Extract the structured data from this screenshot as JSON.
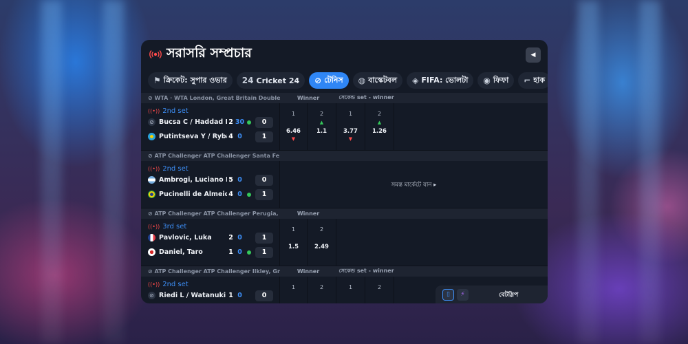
{
  "header": {
    "title": "সরাসরি সম্প্রচার"
  },
  "tabs": [
    {
      "label": "ক্রিকেট: সুপার ওভার",
      "icon": "cricket-icon",
      "active": false
    },
    {
      "label": "Cricket 24",
      "icon": "cricket24-icon",
      "active": false
    },
    {
      "label": "টেনিস",
      "icon": "tennis-icon",
      "active": true
    },
    {
      "label": "বাস্কেটবল",
      "icon": "basketball-icon",
      "active": false
    },
    {
      "label": "FIFA: ভোলটা",
      "icon": "fifa-icon",
      "active": false
    },
    {
      "label": "ফিফা",
      "icon": "soccer-icon",
      "active": false
    },
    {
      "label": "হাক",
      "icon": "hockey-icon",
      "active": false
    }
  ],
  "events": [
    {
      "league": "WTA · WTA London, Great Britain Doubles",
      "market_headers": [
        "Winner",
        "সেকেন্ড set - winner"
      ],
      "set": "2nd set",
      "players": [
        {
          "name": "Bucsa C / Haddad Maia",
          "sets": "2",
          "points": "30",
          "serving": true,
          "games": "0"
        },
        {
          "name": "Putintseva Y / Rybakina",
          "sets": "4",
          "points": "0",
          "serving": false,
          "games": "1"
        }
      ],
      "odds": [
        {
          "label": "1",
          "value": "6.46",
          "trend": "down"
        },
        {
          "label": "2",
          "value": "1.1",
          "trend": "up"
        },
        {
          "label": "1",
          "value": "3.77",
          "trend": "down"
        },
        {
          "label": "2",
          "value": "1.26",
          "trend": "up"
        }
      ]
    },
    {
      "league": "ATP Challenger ATP Challenger Santa Fe",
      "set": "2nd set",
      "players": [
        {
          "name": "Ambrogi, Luciano Emanuel",
          "sets": "5",
          "points": "0",
          "serving": false,
          "games": "0"
        },
        {
          "name": "Pucinelli de Almeida, Matheus",
          "sets": "4",
          "points": "0",
          "serving": true,
          "games": "1"
        }
      ],
      "all_markets": "সমস্ত মার্কেটে যান ▸"
    },
    {
      "league": "ATP Challenger ATP Challenger Perugia, Italy",
      "market_headers": [
        "Winner"
      ],
      "set": "3rd set",
      "players": [
        {
          "name": "Pavlovic, Luka",
          "sets": "2",
          "points": "0",
          "serving": false,
          "games": "1"
        },
        {
          "name": "Daniel, Taro",
          "sets": "1",
          "points": "0",
          "serving": true,
          "games": "1"
        }
      ],
      "odds": [
        {
          "label": "1",
          "value": "1.5",
          "trend": ""
        },
        {
          "label": "2",
          "value": "2.49",
          "trend": ""
        }
      ]
    },
    {
      "league": "ATP Challenger ATP Challenger Ilkley, Great Britain",
      "market_headers": [
        "Winner",
        "সেকেন্ড set - winner"
      ],
      "set": "2nd set",
      "players": [
        {
          "name": "Riedi L / Watanuki Y",
          "sets": "1",
          "points": "0",
          "serving": false,
          "games": "0"
        }
      ],
      "odds": [
        {
          "label": "1",
          "value": "",
          "trend": ""
        },
        {
          "label": "2",
          "value": "",
          "trend": ""
        },
        {
          "label": "1",
          "value": "",
          "trend": ""
        },
        {
          "label": "2",
          "value": "",
          "trend": ""
        }
      ]
    }
  ],
  "betslip": {
    "label": "বেটস্লিপ"
  },
  "colors": {
    "accent": "#2f86f5",
    "live": "#ff4b4b",
    "serve": "#35c85a",
    "panel": "#141a26"
  }
}
